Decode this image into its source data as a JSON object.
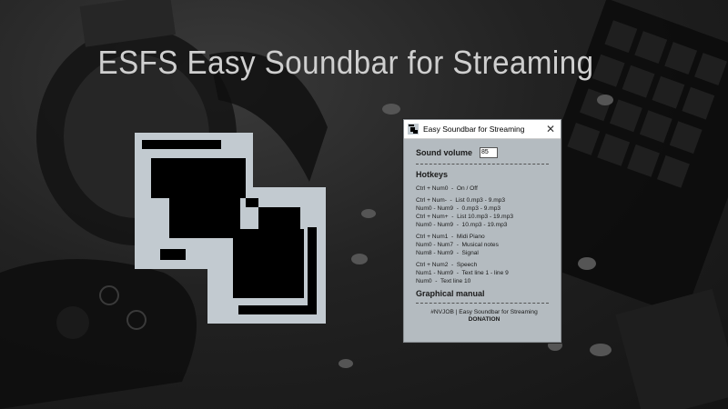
{
  "banner": {
    "headline": "ESFS Easy Soundbar for Streaming"
  },
  "window": {
    "title": "Easy Soundbar for Streaming",
    "close_glyph": "✕",
    "sound_volume_label": "Sound volume",
    "sound_volume_value": "85",
    "hotkeys_title": "Hotkeys",
    "hotkey_groups": [
      [
        "Ctrl + Num0  -  On / Off"
      ],
      [
        "Ctrl + Num-  -  List 0.mp3 - 9.mp3",
        "Num0 - Num9  -  0.mp3 - 9.mp3",
        "Ctrl + Num+  -  List 10.mp3 - 19.mp3",
        "Num0 - Num9  -  10.mp3 - 19.mp3"
      ],
      [
        "Ctrl + Num1  -  Midi Piano",
        "Num0 - Num7  -  Musical notes",
        "Num8 - Num9  -  Signal"
      ],
      [
        "Ctrl + Num2  -  Speech",
        "Num1 - Num9  -  Text line 1 - line 9",
        "Num0  -  Text line 10"
      ]
    ],
    "manual_label": "Graphical manual",
    "footer": "#NVJOB | Easy Soundbar for Streaming",
    "donation_label": "DONATION"
  },
  "icons": {
    "app_icon": "soundbar-app-icon",
    "logo": "esfs-logo-icon",
    "close": "close-icon"
  },
  "colors": {
    "window_bg": "#b4bbc0",
    "logo_fill": "#c2cad0",
    "headline": "#cfcfcf"
  }
}
